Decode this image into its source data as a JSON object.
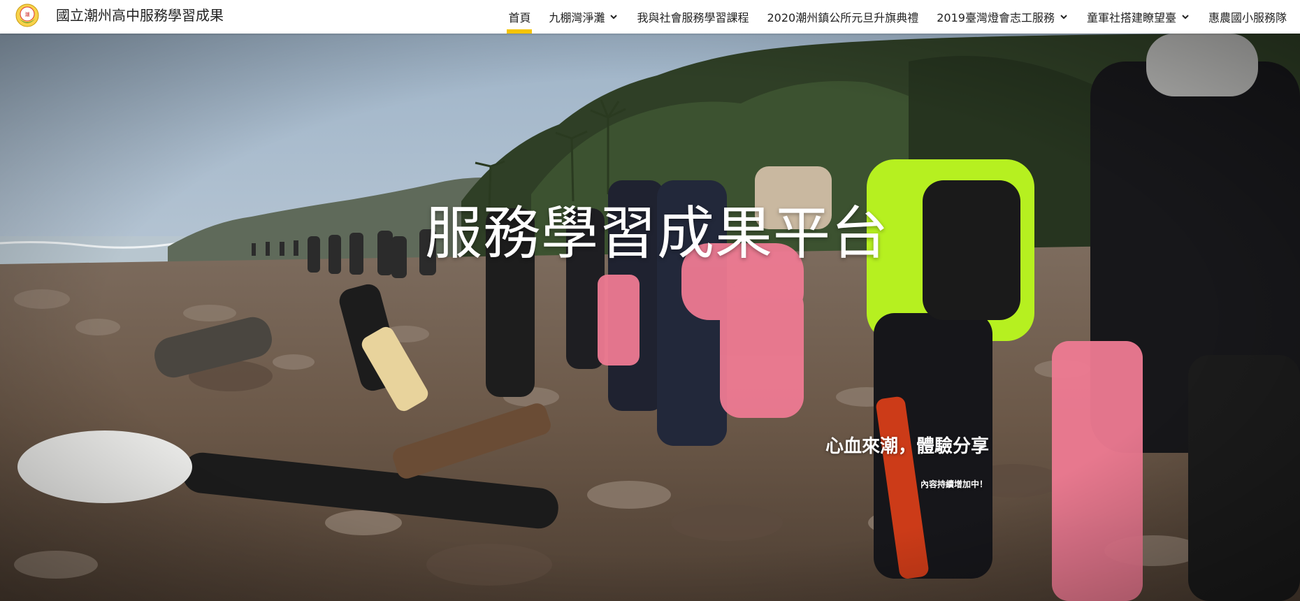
{
  "header": {
    "site_title": "國立潮州高中服務學習成果",
    "logo_icon": "school-emblem-icon"
  },
  "nav": {
    "items": [
      {
        "label": "首頁",
        "active": true,
        "has_dropdown": false
      },
      {
        "label": "九棚灣淨灘",
        "active": false,
        "has_dropdown": true
      },
      {
        "label": "我與社會服務學習課程",
        "active": false,
        "has_dropdown": false
      },
      {
        "label": "2020潮州鎮公所元旦升旗典禮",
        "active": false,
        "has_dropdown": false
      },
      {
        "label": "2019臺灣燈會志工服務",
        "active": false,
        "has_dropdown": true
      },
      {
        "label": "童軍社搭建瞭望臺",
        "active": false,
        "has_dropdown": true
      },
      {
        "label": "惠農國小服務隊",
        "active": false,
        "has_dropdown": false
      }
    ],
    "active_color": "#f5c400"
  },
  "hero": {
    "title": "服務學習成果平台",
    "subtitle": "心血來潮，體驗分享",
    "note": "內容持續增加中！"
  }
}
